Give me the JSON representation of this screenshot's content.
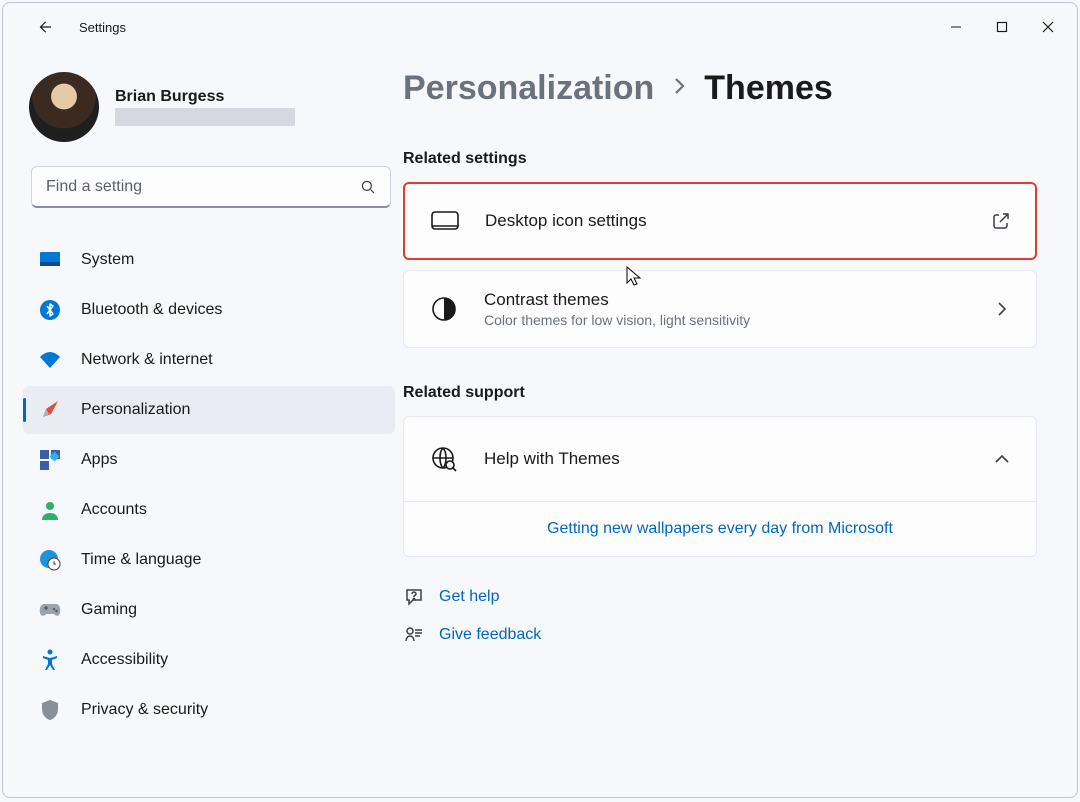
{
  "titlebar": {
    "app_title": "Settings"
  },
  "profile": {
    "name": "Brian Burgess"
  },
  "search": {
    "placeholder": "Find a setting"
  },
  "nav": {
    "items": [
      {
        "label": "System"
      },
      {
        "label": "Bluetooth & devices"
      },
      {
        "label": "Network & internet"
      },
      {
        "label": "Personalization"
      },
      {
        "label": "Apps"
      },
      {
        "label": "Accounts"
      },
      {
        "label": "Time & language"
      },
      {
        "label": "Gaming"
      },
      {
        "label": "Accessibility"
      },
      {
        "label": "Privacy & security"
      }
    ]
  },
  "breadcrumb": {
    "parent": "Personalization",
    "current": "Themes"
  },
  "related_settings": {
    "heading": "Related settings",
    "items": [
      {
        "title": "Desktop icon settings"
      },
      {
        "title": "Contrast themes",
        "sub": "Color themes for low vision, light sensitivity"
      }
    ]
  },
  "related_support": {
    "heading": "Related support",
    "head_title": "Help with Themes",
    "link": "Getting new wallpapers every day from Microsoft"
  },
  "footer": {
    "get_help": "Get help",
    "give_feedback": "Give feedback"
  }
}
